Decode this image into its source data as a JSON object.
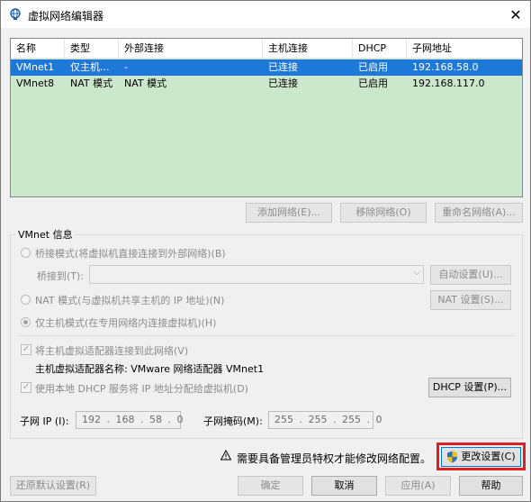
{
  "window": {
    "title": "虚拟网络编辑器",
    "close_glyph": "✕"
  },
  "table": {
    "columns": [
      "名称",
      "类型",
      "外部连接",
      "主机连接",
      "DHCP",
      "子网地址"
    ],
    "rows": [
      {
        "name": "VMnet1",
        "type": "仅主机...",
        "external": "-",
        "host": "已连接",
        "dhcp": "已启用",
        "subnet": "192.168.58.0",
        "selected": true
      },
      {
        "name": "VMnet8",
        "type": "NAT 模式",
        "external": "NAT 模式",
        "host": "已连接",
        "dhcp": "已启用",
        "subnet": "192.168.117.0",
        "selected": false
      }
    ]
  },
  "table_buttons": {
    "add": "添加网络(E)...",
    "remove": "移除网络(O)",
    "rename": "重命名网络(A)..."
  },
  "vmnet_info": {
    "title": "VMnet 信息",
    "bridge_mode": "桥接模式(将虚拟机直接连接到外部网络)(B)",
    "bridge_to_label": "桥接到(T):",
    "bridge_to_value": "",
    "auto_settings": "自动设置(U)...",
    "nat_mode": "NAT 模式(与虚拟机共享主机的 IP 地址)(N)",
    "nat_settings": "NAT 设置(S)...",
    "host_only": "仅主机模式(在专用网络内连接虚拟机)(H)",
    "connect_adapter": "将主机虚拟适配器连接到此网络(V)",
    "adapter_name": "主机虚拟适配器名称: VMware 网络适配器 VMnet1",
    "use_dhcp": "使用本地 DHCP 服务将 IP 地址分配给虚拟机(D)",
    "dhcp_settings": "DHCP 设置(P)...",
    "subnet_ip_label": "子网 IP (I):",
    "subnet_ip_value": "192 . 168 . 58 . 0",
    "subnet_mask_label": "子网掩码(M):",
    "subnet_mask_value": "255 . 255 . 255 . 0"
  },
  "footer": {
    "admin_notice": "需要具备管理员特权才能修改网络配置。",
    "change_settings": "更改设置(C)",
    "restore_defaults": "还原默认设置(R)",
    "ok": "确定",
    "cancel": "取消",
    "apply": "应用(A)",
    "help": "帮助"
  },
  "colors": {
    "selection": "#1e78d7",
    "table_bg": "#cce8cc",
    "highlight": "#e02020"
  }
}
